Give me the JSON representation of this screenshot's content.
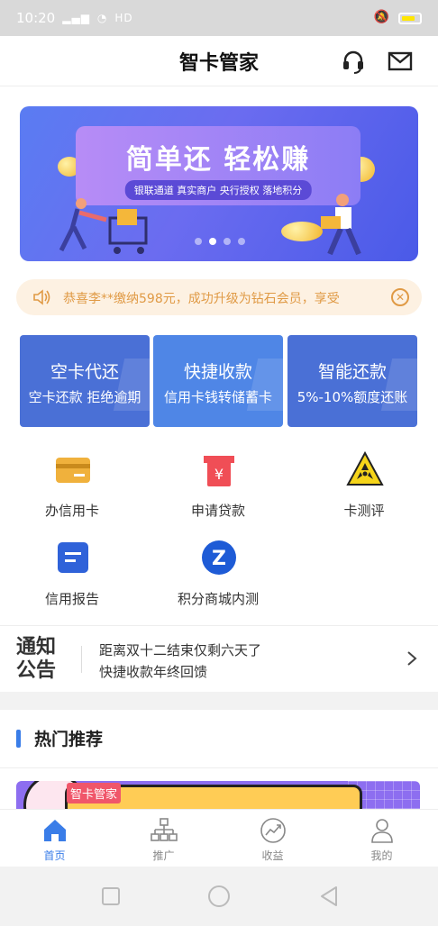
{
  "status": {
    "time": "10:20",
    "network": "HD"
  },
  "header": {
    "title": "智卡管家"
  },
  "banner": {
    "headline": "简单还 轻松赚",
    "tagline": "银联通道 真实商户 央行授权 落地积分",
    "active_dot": 2,
    "dot_count": 4
  },
  "notice": {
    "text": "恭喜李**缴纳598元，成功升级为钻石会员，享受"
  },
  "cards": [
    {
      "title": "空卡代还",
      "subtitle": "空卡还款 拒绝逾期",
      "color": "#4a70d6"
    },
    {
      "title": "快捷收款",
      "subtitle": "信用卡钱转储蓄卡",
      "color": "#4f86e6"
    },
    {
      "title": "智能还款",
      "subtitle": "5%-10%额度还账",
      "color": "#4a70d6"
    }
  ],
  "services": [
    {
      "label": "办信用卡",
      "icon": "credit-card-icon"
    },
    {
      "label": "申请贷款",
      "icon": "loan-icon"
    },
    {
      "label": "卡测评",
      "icon": "radiation-icon"
    },
    {
      "label": "信用报告",
      "icon": "report-icon"
    },
    {
      "label": "积分商城内测",
      "icon": "points-mall-icon"
    }
  ],
  "announcement": {
    "logo": "通知公告",
    "line1": "距离双十二结束仅剩六天了",
    "line2": "快捷收款年终回馈"
  },
  "hot": {
    "title": "热门推荐"
  },
  "promo": {
    "tag": "智卡管家"
  },
  "tabs": [
    {
      "label": "首页",
      "icon": "home-icon",
      "active": true
    },
    {
      "label": "推广",
      "icon": "org-chart-icon",
      "active": false
    },
    {
      "label": "收益",
      "icon": "chart-icon",
      "active": false
    },
    {
      "label": "我的",
      "icon": "user-icon",
      "active": false
    }
  ],
  "colors": {
    "accent": "#3a7de8",
    "notice_text": "#e09a45",
    "notice_bg": "#fdf1e2"
  }
}
